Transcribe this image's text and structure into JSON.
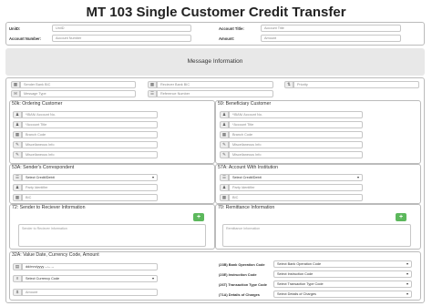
{
  "page": {
    "title": "MT 103 Single Customer Credit Transfer"
  },
  "header": {
    "uniqid_label": "UniID:",
    "uniqid_placeholder": "UniID",
    "account_number_label": "Account Number:",
    "account_number_placeholder": "Account Number",
    "account_title_label": "Account Title:",
    "account_title_placeholder": "Account Title",
    "amount_label": "Amount:",
    "amount_placeholder": "Amount"
  },
  "message_info": {
    "title": "Message Information"
  },
  "top_row": {
    "sender_bank_bic": "Sender Bank BIC",
    "receiver_bank_bic": "Reciever Bank BIC",
    "priority": "Priority",
    "message_type": "Message Type",
    "reference_number": "Reference Number"
  },
  "ordering_customer": {
    "title": "50k: Ordering Customer",
    "fields": [
      "*IBAN/ Account No.",
      "*Account Title",
      "Branch Code",
      "Miscellaneous Info",
      "Miscellaneous Info"
    ]
  },
  "beneficiary_customer": {
    "title": "59: Beneficiary Customer",
    "fields": [
      "*IBAN/ Account No.",
      "*Account Title",
      "Branch Code",
      "Miscellaneous Info",
      "Miscellaneous Info"
    ]
  },
  "senders_correspondent": {
    "title": "53A: Sender's Correspondent",
    "select_value": "Select Credit/Debit",
    "party_identifier": "Party Identifier",
    "bic": "BIC"
  },
  "account_with_institution": {
    "title": "57A: Account With Institution",
    "select_value": "Select Credit/Debit",
    "party_identifier": "Party Identifier",
    "bic": "BIC"
  },
  "sender_to_receiver": {
    "title": "72: Sender to Reciever Information",
    "placeholder": "Sender to Reciever Information",
    "add_label": "+"
  },
  "remittance": {
    "title": "70: Remittance Information",
    "placeholder": "Remittance Information",
    "add_label": "+"
  },
  "value_date": {
    "title": "32A: Value Date, Currency Code, Amount",
    "date_placeholder": "dd/mm/yyyy  --:-- --",
    "currency_select": "Select Currency Code",
    "amount_placeholder": "Amount"
  },
  "codes": {
    "bank_operation_label": "(23B) Bank Operation Code",
    "bank_operation_select": "Select Bank Operation Code",
    "instruction_label": "(23E) Instruction Code",
    "instruction_select": "Select Instruction Code",
    "transaction_type_label": "(26T) Transaction Type Code",
    "transaction_type_select": "Select Transaction Type Code",
    "details_of_charges_label": "(71A) Details of Charges",
    "details_of_charges_select": "Select Details of Charges"
  },
  "colors": {
    "add_button": "#5cb85c",
    "message_bar": "#e8e8e8"
  }
}
